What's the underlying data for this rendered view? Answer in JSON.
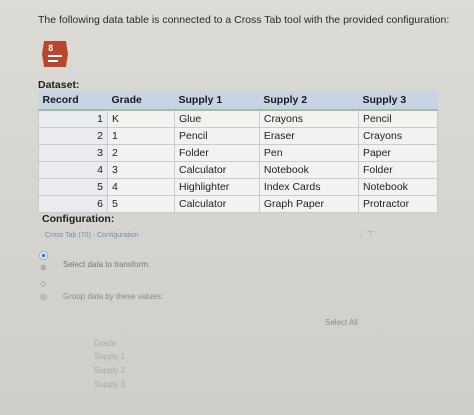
{
  "question": "The following data table is connected to a Cross Tab tool with the provided configuration:",
  "dataset_label": "Dataset:",
  "table": {
    "headers": [
      "Record",
      "Grade",
      "Supply 1",
      "Supply 2",
      "Supply 3"
    ],
    "rows": [
      [
        "1",
        "K",
        "Glue",
        "Crayons",
        "Pencil"
      ],
      [
        "2",
        "1",
        "Pencil",
        "Eraser",
        "Crayons"
      ],
      [
        "3",
        "2",
        "Folder",
        "Pen",
        "Paper"
      ],
      [
        "4",
        "3",
        "Calculator",
        "Notebook",
        "Folder"
      ],
      [
        "5",
        "4",
        "Highlighter",
        "Index Cards",
        "Notebook"
      ],
      [
        "6",
        "5",
        "Calculator",
        "Graph Paper",
        "Protractor"
      ]
    ]
  },
  "configuration": {
    "label": "Configuration:",
    "tool_title": "Cross Tab (70) - Configuration",
    "pin_glyph": "⋮ ⊤",
    "step1": "Select data to transform.",
    "step2": "Group data by these values:",
    "select_all": "Select All",
    "fields": [
      "Grade",
      "Supply 1",
      "Supply 2",
      "Supply 3"
    ]
  },
  "icons": {
    "tool": "cross-tab-icon",
    "side": [
      "radio-selected-icon",
      "gear-icon",
      "tag-icon",
      "question-icon"
    ]
  },
  "colors": {
    "header_bg": "#c8d4e4",
    "header_rule": "#9cc0a6",
    "tool_icon": "#b9472e",
    "config_title": "#7a8bb0"
  }
}
